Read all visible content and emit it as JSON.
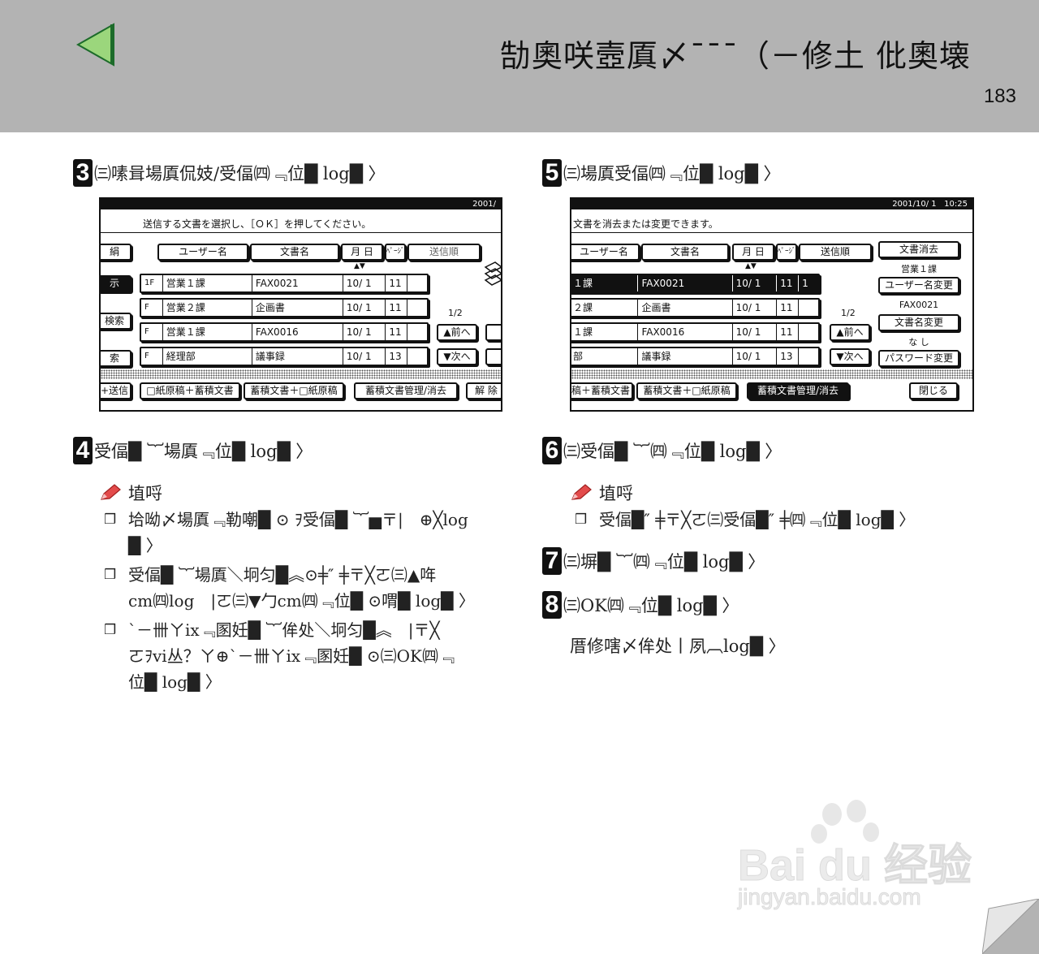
{
  "header": {
    "title": "勂奧咲壼厧〆¯¯¯（－修土 仳奧壊",
    "page_number": "183"
  },
  "left": {
    "step3": {
      "num": "3",
      "text": "㈢嗉咠場厧侃妓/受偪㈣﹃位█ log█ 〉"
    },
    "screen1": {
      "clock": "2001/",
      "message": "送信する文書を選択し、［ＯＫ］を押してください。",
      "side_tabs": [
        "絹",
        "示",
        "検索",
        "索"
      ],
      "headers": [
        "ユーザー名",
        "文書名",
        "月 日",
        "ﾍﾟｰｼﾞ",
        "送信順"
      ],
      "rows": [
        {
          "icon": "1F",
          "user": "営業１課",
          "doc": "FAX0021",
          "date": "10/ 1",
          "pages": "11"
        },
        {
          "icon": "F",
          "user": "営業２課",
          "doc": "企画書",
          "date": "10/ 1",
          "pages": "11"
        },
        {
          "icon": "F",
          "user": "営業１課",
          "doc": "FAX0016",
          "date": "10/ 1",
          "pages": "11"
        },
        {
          "icon": "F",
          "user": "経理部",
          "doc": "議事録",
          "date": "10/ 1",
          "pages": "13"
        }
      ],
      "page_indicator": "1/2",
      "prev": "▲前へ",
      "next": "▼次へ",
      "bottom_tabs": [
        "+送信",
        "□紙原稿＋蓄積文書",
        "蓄積文書＋□紙原稿",
        "蓄積文書管理/消去",
        "解 除"
      ]
    },
    "step4": {
      "num": "4",
      "text": "受偪█ ︸場厧﹃位█ log█ 〉"
    },
    "note_title": "埴哷",
    "bullets": [
      "垥呦〆場厧﹃勒嘲█ ⊙ ｦ受偪█ ︸▅〒|　⊕╳log\n█ 〉",
      "受偪█ ︸場厧＼坰匀█︽⊙╪″ ╪〒╳ㄛ㈢▲哖\ncm㈣log　|ㄛ㈢▼勹cm㈣﹃位█ ⊙喟█ log█ 〉",
      "ˋ－卌ㄚix﹃圂妊█ ︸侔处＼坰匀█︽　|〒╳\nㄛｦvi丛？ㄚ⊕ˋ－卌ㄚix﹃圂妊█ ⊙㈢OK㈣﹃\n位█ log█ 〉"
    ]
  },
  "right": {
    "step5": {
      "num": "5",
      "text": "㈢場厧受偪㈣﹃位█ log█ 〉"
    },
    "screen2": {
      "clock": "2001/10/ 1   10:25",
      "message": "文書を消去または変更できます。",
      "headers": [
        "ユーザー名",
        "文書名",
        "月 日",
        "ﾍﾟｰｼﾞ",
        "送信順"
      ],
      "rows": [
        {
          "user": "１課",
          "doc": "FAX0021",
          "date": "10/ 1",
          "pages": "11",
          "order": "1"
        },
        {
          "user": "２課",
          "doc": "企画書",
          "date": "10/ 1",
          "pages": "11",
          "order": ""
        },
        {
          "user": "１課",
          "doc": "FAX0016",
          "date": "10/ 1",
          "pages": "11",
          "order": ""
        },
        {
          "user": "部",
          "doc": "議事録",
          "date": "10/ 1",
          "pages": "13",
          "order": ""
        }
      ],
      "page_indicator": "1/2",
      "prev": "▲前へ",
      "next": "▼次へ",
      "side_buttons": {
        "delete": "文書消去",
        "user_label": "営業１課",
        "user_change": "ユーザー名変更",
        "doc_label": "FAX0021",
        "doc_change": "文書名変更",
        "pw_label": "な し",
        "pw_change": "パスワード変更"
      },
      "bottom_tabs": [
        "稿＋蓄積文書",
        "蓄積文書＋□紙原稿",
        "蓄積文書管理/消去",
        "閉じる"
      ]
    },
    "step6": {
      "num": "6",
      "text": "㈢受偪█ ︸㈣﹃位█ log█ 〉"
    },
    "note_title": "埴哷",
    "bullet": "受偪█″ ╪〒╳ㄛ㈢受偪█″ ╪㈣﹃位█ log█ 〉",
    "step7": {
      "num": "7",
      "text": "㈢塀█ ︸㈣﹃位█ log█ 〉"
    },
    "step8": {
      "num": "8",
      "text": "㈢OK㈣﹃位█ log█ 〉"
    },
    "final_text": "厝修嗐〆侔处丨夙︹log█ 〉"
  },
  "watermark": {
    "brand": "Bai du 经验",
    "url": "jingyan.baidu.com"
  },
  "colors": {
    "header_bg": "#b3b3b3",
    "arrow_green": "#8fcf6f"
  }
}
